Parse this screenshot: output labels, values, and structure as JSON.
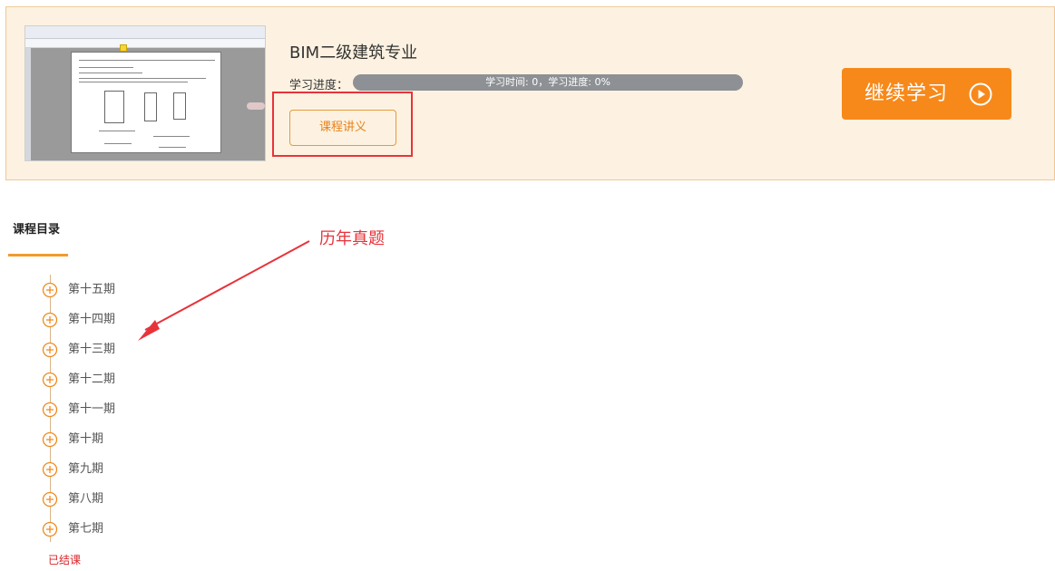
{
  "course": {
    "title": "BIM二级建筑专业",
    "progress_label": "学习进度：",
    "progress_text": "学习时间: 0，学习进度: 0%",
    "progress_fraction": 0,
    "handout_button": "课程讲义",
    "continue_button": "继续学习"
  },
  "catalog": {
    "heading": "课程目录",
    "periods": [
      "第十五期",
      "第十四期",
      "第十三期",
      "第十二期",
      "第十一期",
      "第十期",
      "第九期",
      "第八期",
      "第七期"
    ],
    "ended_label": "已结课"
  },
  "annotation": {
    "text": "历年真题"
  },
  "colors": {
    "accent": "#f7891a",
    "card_background": "#fdf2e1",
    "highlight": "#e8333a",
    "progress_track": "#8d9094"
  },
  "icons": {
    "continue": "play-circle-icon",
    "period": "plus-circle-icon"
  }
}
